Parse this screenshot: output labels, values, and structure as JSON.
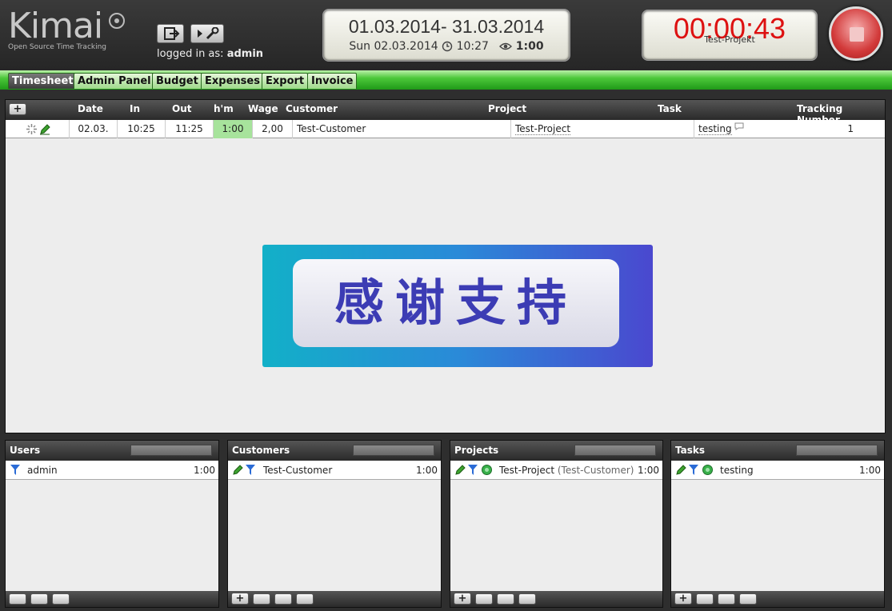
{
  "header": {
    "brand": "Kimai",
    "tagline": "Open Source Time Tracking",
    "logged_in_prefix": "logged in as:",
    "logged_in_user": "admin",
    "date_range": "01.03.2014-  31.03.2014",
    "current_date": "Sun 02.03.2014",
    "current_time": "10:27",
    "total_time": "1:00",
    "timer": "00:00:43",
    "timer_project": "Test-Projekt"
  },
  "tabs": [
    "Timesheet",
    "Admin Panel",
    "Budget",
    "Expenses",
    "Export",
    "Invoice"
  ],
  "timesheet": {
    "columns": [
      "Date",
      "In",
      "Out",
      "h'm",
      "Wage",
      "Customer",
      "Project",
      "Task",
      "Tracking Number"
    ],
    "rows": [
      {
        "date": "02.03.",
        "in": "10:25",
        "out": "11:25",
        "hm": "1:00",
        "wage": "2,00",
        "customer": "Test-Customer",
        "project": "Test-Project",
        "task": "testing",
        "tracking": "1"
      }
    ],
    "banner_text": "感谢支持"
  },
  "panels": {
    "users": {
      "title": "Users",
      "rows": [
        {
          "name": "admin",
          "value": "1:00"
        }
      ]
    },
    "customers": {
      "title": "Customers",
      "rows": [
        {
          "name": "Test-Customer",
          "value": "1:00"
        }
      ]
    },
    "projects": {
      "title": "Projects",
      "rows": [
        {
          "name": "Test-Project",
          "customer": "(Test-Customer)",
          "value": "1:00"
        }
      ]
    },
    "tasks": {
      "title": "Tasks",
      "rows": [
        {
          "name": "testing",
          "value": "1:00"
        }
      ]
    }
  },
  "colors": {
    "accent_green": "#4cc83a",
    "timer_red": "#dd1111",
    "hm_highlight": "#a7e39c"
  }
}
